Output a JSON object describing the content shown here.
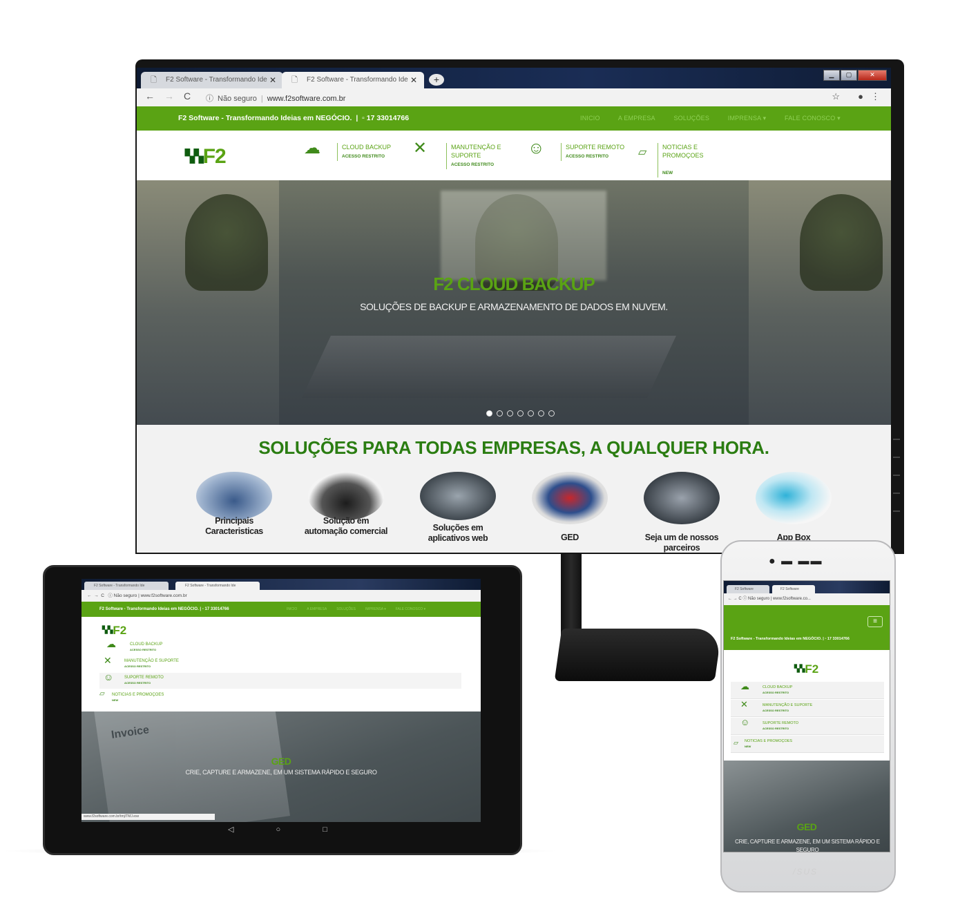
{
  "browser": {
    "tab1_title": "F2 Software - Transformando Ide",
    "tab2_title": "F2 Software - Transformando Ide",
    "security": "Não seguro",
    "url": "www.f2software.com.br"
  },
  "site": {
    "tagline": "F2 Software - Transformando Ideias em NEGÓCIO.",
    "phone": "17 33014766",
    "logo": "F2",
    "menu": [
      "INICIO",
      "A EMPRESA",
      "SOLUÇÕES",
      "IMPRENSA ▾",
      "FALE CONOSCO ▾"
    ],
    "services": [
      {
        "title": "CLOUD BACKUP",
        "sub": "ACESSO RESTRITO",
        "icon": "cloud-upload-icon"
      },
      {
        "title": "MANUTENÇÃO E SUPORTE",
        "sub": "ACESSO RESTRITO",
        "icon": "tools-icon"
      },
      {
        "title": "SUPORTE REMOTO",
        "sub": "ACESSO RESTRITO",
        "icon": "remote-support-icon"
      },
      {
        "title": "NOTICIAS E PROMOÇOES",
        "sub": "NEW",
        "icon": "newspaper-icon"
      }
    ],
    "hero": {
      "title": "F2 CLOUD BACKUP",
      "caption": "SOLUÇÕES DE BACKUP E ARMAZENAMENTO DE DADOS EM NUVEM.",
      "slide_count": 7,
      "active_slide": 1
    },
    "solutions_heading": "SOLUÇÕES PARA TODAS EMPRESAS, A QUALQUER HORA.",
    "solutions": [
      "Principais Caracteristicas",
      "Solução em automação comercial",
      "Soluções em aplicativos web",
      "GED",
      "Seja um de nossos parceiros",
      "App Box"
    ]
  },
  "tablet": {
    "hero_title": "GED",
    "hero_caption": "CRIE, CAPTURE E ARMAZENE, EM UM SISTEMA RÁPIDO E SEGURO",
    "status_url": "www.f2software.com.br/tmj/TMJ.exe",
    "paper_text": "Invoice",
    "tab2_title": "F2 Software - Transformando Ide",
    "nav_buttons": "◁ ○ □"
  },
  "phone": {
    "tab1_title": "F2 Software",
    "tab2_title": "F2 Software",
    "url": "www.f2software.co...",
    "hero_title": "GED",
    "hero_caption": "CRIE, CAPTURE E ARMAZENE, EM UM SISTEMA RÁPIDO E SEGURO",
    "brand": "/SUS"
  },
  "colors": {
    "brand_green": "#5aa314",
    "dark_green": "#2b7d12"
  }
}
